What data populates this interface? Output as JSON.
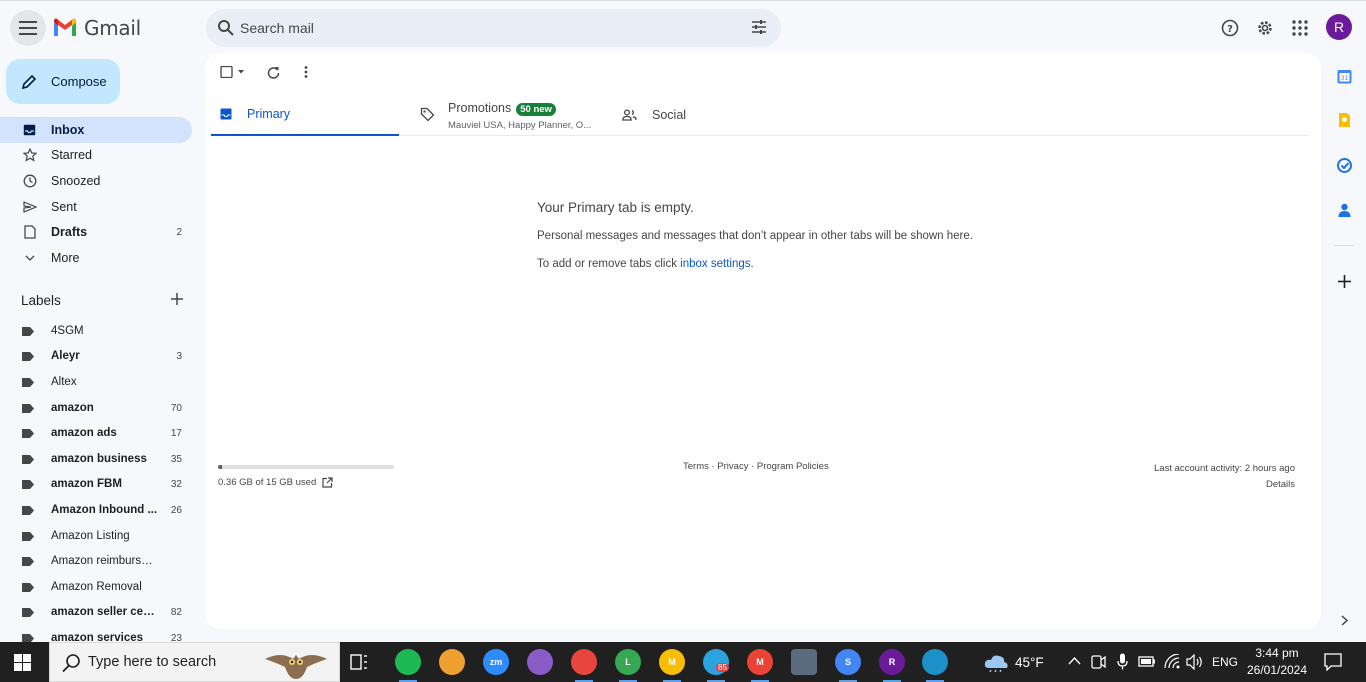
{
  "header": {
    "app_name": "Gmail",
    "search_placeholder": "Search mail",
    "avatar_initial": "R"
  },
  "sidebar": {
    "compose_label": "Compose",
    "nav": [
      {
        "label": "Inbox",
        "icon": "inbox-icon",
        "count": "",
        "active": true
      },
      {
        "label": "Starred",
        "icon": "star-icon",
        "count": ""
      },
      {
        "label": "Snoozed",
        "icon": "clock-icon",
        "count": ""
      },
      {
        "label": "Sent",
        "icon": "send-icon",
        "count": ""
      },
      {
        "label": "Drafts",
        "icon": "draft-icon",
        "count": "2"
      },
      {
        "label": "More",
        "icon": "chevron-down-icon",
        "count": ""
      }
    ],
    "labels_title": "Labels",
    "labels": [
      {
        "label": "4SGM",
        "count": "",
        "bold": false
      },
      {
        "label": "Aleyr",
        "count": "3",
        "bold": true
      },
      {
        "label": "Altex",
        "count": "",
        "bold": false
      },
      {
        "label": "amazon",
        "count": "70",
        "bold": true
      },
      {
        "label": "amazon ads",
        "count": "17",
        "bold": true
      },
      {
        "label": "amazon business",
        "count": "35",
        "bold": true
      },
      {
        "label": "amazon FBM",
        "count": "32",
        "bold": true
      },
      {
        "label": "Amazon Inbound ...",
        "count": "26",
        "bold": true
      },
      {
        "label": "Amazon Listing",
        "count": "",
        "bold": false
      },
      {
        "label": "Amazon reimbursement",
        "count": "",
        "bold": false
      },
      {
        "label": "Amazon Removal",
        "count": "",
        "bold": false
      },
      {
        "label": "amazon seller cen...",
        "count": "82",
        "bold": true
      },
      {
        "label": "amazon services",
        "count": "23",
        "bold": true
      }
    ]
  },
  "tabs": {
    "primary": "Primary",
    "promotions": "Promotions",
    "promotions_badge": "50 new",
    "promotions_sub": "Mauviel USA, Happy Planner, O...",
    "social": "Social"
  },
  "empty": {
    "title": "Your Primary tab is empty.",
    "line1": "Personal messages and messages that don’t appear in other tabs will be shown here.",
    "line2_prefix": "To add or remove tabs click ",
    "line2_link": "inbox settings",
    "line2_suffix": "."
  },
  "footer": {
    "storage": "0.36 GB of 15 GB used",
    "storage_fraction": 0.024,
    "links": "Terms · Privacy · Program Policies",
    "last_activity": "Last account activity: 2 hours ago",
    "details": "Details"
  },
  "taskbar": {
    "search_text": "Type here to search",
    "weather": "45°F",
    "lang": "ENG",
    "time": "3:44 pm",
    "date": "26/01/2024",
    "apps": [
      {
        "name": "spotify",
        "color": "#1db954",
        "label": ""
      },
      {
        "name": "game",
        "color": "#f0a030",
        "label": ""
      },
      {
        "name": "zoom",
        "color": "#2d8cff",
        "label": "zm"
      },
      {
        "name": "paint",
        "color": "#8a5cc7",
        "label": ""
      },
      {
        "name": "chrome-1",
        "color": "#e8453c",
        "label": ""
      },
      {
        "name": "chrome-2",
        "color": "#34a853",
        "label": "L"
      },
      {
        "name": "chrome-3",
        "color": "#fbbc05",
        "label": "M"
      },
      {
        "name": "telegram",
        "color": "#2aa3de",
        "label": ""
      },
      {
        "name": "chrome-4",
        "color": "#ea4335",
        "label": "M"
      },
      {
        "name": "calculator",
        "color": "#5a6b7d",
        "label": ""
      },
      {
        "name": "chrome-5",
        "color": "#4285f4",
        "label": "S"
      },
      {
        "name": "chrome-6",
        "color": "#6a1b9a",
        "label": "R"
      },
      {
        "name": "edge",
        "color": "#1e90c8",
        "label": ""
      }
    ],
    "telegram_badge": "85"
  },
  "colors": {
    "accent": "#0b57d0",
    "compose_bg": "#c2e7ff",
    "active_nav": "#d3e3fd",
    "badge_green": "#188038"
  }
}
